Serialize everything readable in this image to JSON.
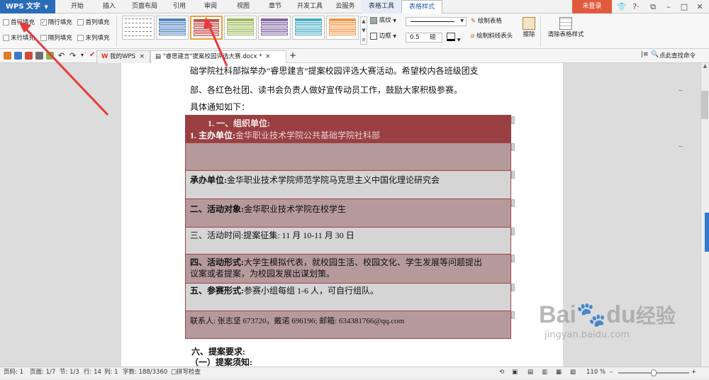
{
  "menubar": {
    "app_button": "WPS 文字",
    "tabs": [
      "开始",
      "插入",
      "页面布局",
      "引用",
      "审阅",
      "视图",
      "章节",
      "开发工具",
      "云服务",
      "表格工具",
      "表格样式"
    ],
    "active_tab": "表格样式",
    "login_button": "未登录",
    "help_label": "?·"
  },
  "ribbon": {
    "checkboxes": {
      "first_row_fill": "首行填充",
      "banded_row_fill": "隔行填充",
      "first_col_fill": "首列填充",
      "last_row_fill": "末行填充",
      "banded_col_fill": "隔列填充",
      "last_col_fill": "末列填充"
    },
    "shading_label": "底纹",
    "border_label": "边框",
    "pen_width": "0.5",
    "pen_unit": "磅",
    "draw_table": "绘制表格",
    "draw_diagonal": "绘制斜线表头",
    "erase": "擦除",
    "clear_style": "清除表格样式",
    "style_colors": [
      "#7f7f7f",
      "#4f81bd",
      "#c0504d",
      "#9bbb59",
      "#8064a2",
      "#4bacc6",
      "#f79646"
    ]
  },
  "quickbar": {
    "my_wps_tab": "我的WPS",
    "doc_tab": "\"睿思建言\"提案校园评选大赛.docx *",
    "find_cmd": "点此查找命令",
    "brand_color": "#e0352b"
  },
  "document": {
    "line1": "础学院社科部拟举办“睿思建言”提案校园评选大赛活动。希望校内各班级团支",
    "line2": "部、各红色社团、读书会负责人做好宣传动员工作，鼓励大家积极参赛。",
    "line3": "具体通知如下：",
    "table": {
      "row1_heading": "1.  一、组织单位:",
      "row1_label": "1. 主办单位:",
      "row1_value": "金华职业技术学院公共基础学院社科部",
      "row3_label": "承办单位:",
      "row3_value": "金华职业技术学院师范学院马克思主义中国化理论研究会",
      "row4_label": "二、活动对象:",
      "row4_value": "金华职业技术学院在校学生",
      "row5_label": "三、活动时间:",
      "row5_value": "提案征集: 11 月 10-11 月 30 日",
      "row6_label": "四、活动形式:",
      "row6_value": "大学生模拟代表，就校园生活、校园文化、学生发展等问题提出",
      "row6_value2": "议案或者提案，为校园发展出谋划策。",
      "row7_label": "五、参赛形式:",
      "row7_value": "参赛小组每组 1-6 人，可自行组队。",
      "row8_value": "联系人: 张志坚 673720，戴诺 696196; 邮箱: 634381766@qq.com",
      "color_dark": "#9a3f42",
      "color_light": "#b69a9b",
      "color_grey": "#d5d5d5"
    },
    "line4": "六、提案要求:",
    "line5": "（一）提案须知:"
  },
  "statusbar": {
    "page_no": "页码: 1",
    "pages": "页面: 1/7",
    "section": "节: 1/3",
    "row": "行: 14",
    "col": "列: 1",
    "words": "字数: 188/3360",
    "spell": "拼写检查",
    "zoom": "110 %"
  },
  "watermark": {
    "brand": "Bai",
    "brand2": "du",
    "suffix": "经验",
    "url": "jingyan.baidu.com"
  }
}
